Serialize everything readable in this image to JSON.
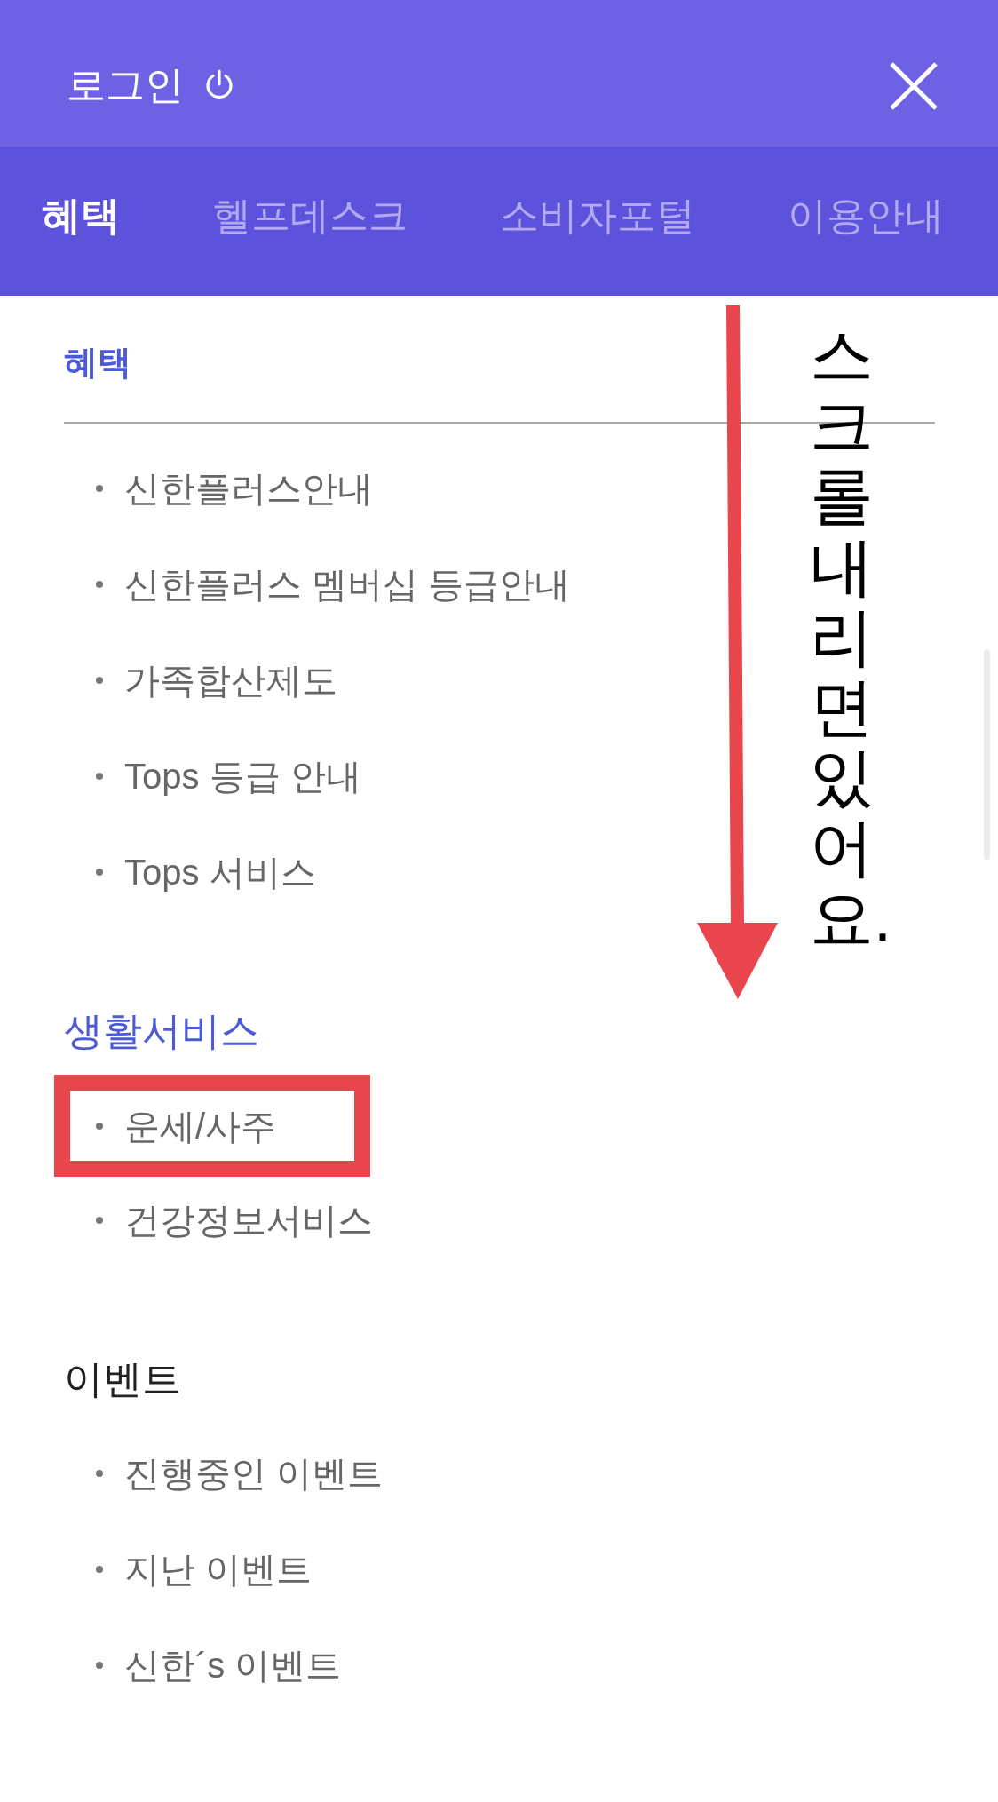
{
  "header": {
    "login_label": "로그인"
  },
  "tabs": [
    {
      "label": "혜택",
      "selected": true
    },
    {
      "label": "헬프데스크",
      "selected": false
    },
    {
      "label": "소비자포털",
      "selected": false
    },
    {
      "label": "이용안내",
      "selected": false
    }
  ],
  "category": {
    "title": "혜택",
    "items": [
      {
        "label": "신한플러스안내",
        "highlighted": false
      },
      {
        "label": "신한플러스 멤버십 등급안내",
        "highlighted": false
      },
      {
        "label": "가족합산제도",
        "highlighted": false
      },
      {
        "label": "Tops 등급 안내",
        "highlighted": false
      },
      {
        "label": "Tops 서비스",
        "highlighted": false
      }
    ]
  },
  "sections": [
    {
      "title": "생활서비스",
      "selected": true,
      "items": [
        {
          "label": "운세/사주",
          "highlighted": true
        },
        {
          "label": "건강정보서비스",
          "highlighted": false
        }
      ]
    },
    {
      "title": "이벤트",
      "selected": false,
      "items": [
        {
          "label": "진행중인 이벤트",
          "highlighted": false
        },
        {
          "label": "지난 이벤트",
          "highlighted": false
        },
        {
          "label": "신한´s 이벤트",
          "highlighted": false
        }
      ]
    }
  ],
  "annotation": {
    "text": "스크롤내리면있어요."
  }
}
